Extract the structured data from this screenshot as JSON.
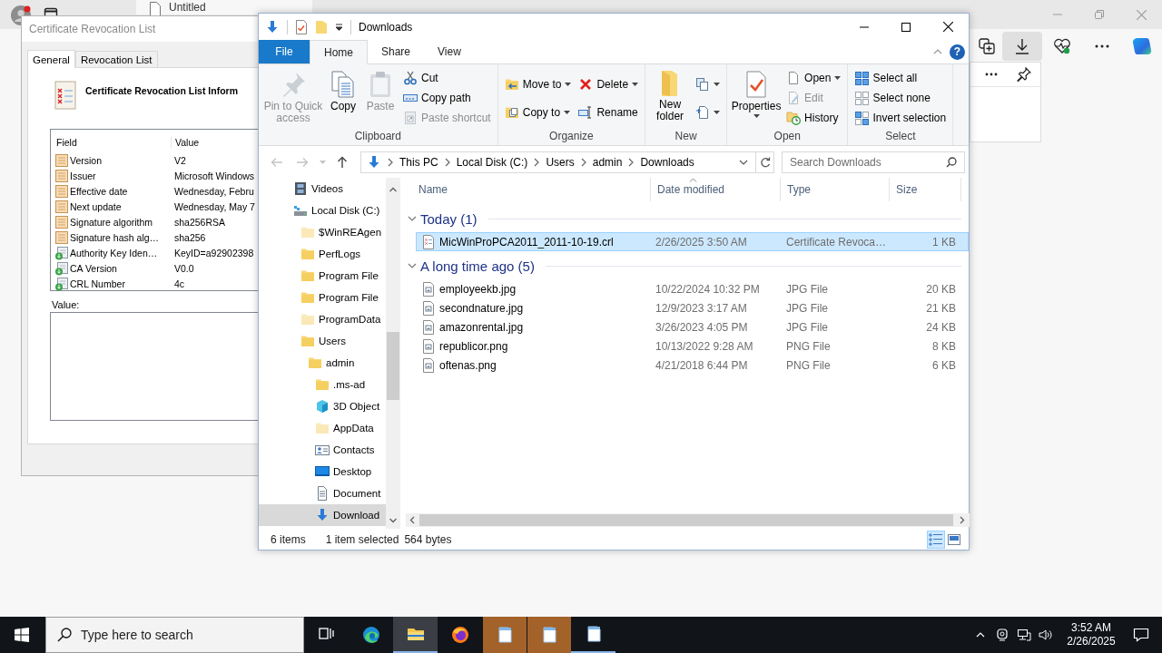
{
  "browser": {
    "tab_title": "Untitled"
  },
  "cert_dialog": {
    "title": "Certificate Revocation List",
    "tabs": [
      {
        "label": "General",
        "selected": true
      },
      {
        "label": "Revocation List",
        "selected": false
      }
    ],
    "heading": "Certificate Revocation List Inform",
    "columns": [
      "Field",
      "Value"
    ],
    "rows": [
      {
        "field": "Version",
        "value": "V2",
        "kind": "property"
      },
      {
        "field": "Issuer",
        "value": "Microsoft Windows",
        "kind": "property"
      },
      {
        "field": "Effective date",
        "value": "Wednesday, Febru",
        "kind": "property"
      },
      {
        "field": "Next update",
        "value": "Wednesday, May 7",
        "kind": "property"
      },
      {
        "field": "Signature algorithm",
        "value": "sha256RSA",
        "kind": "property"
      },
      {
        "field": "Signature hash alg…",
        "value": "sha256",
        "kind": "property"
      },
      {
        "field": "Authority Key Iden…",
        "value": "KeyID=a92902398",
        "kind": "extension"
      },
      {
        "field": "CA Version",
        "value": "V0.0",
        "kind": "extension"
      },
      {
        "field": "CRL Number",
        "value": "4c",
        "kind": "extension"
      }
    ],
    "value_label": "Value:"
  },
  "explorer": {
    "title": "Downloads",
    "ribbon": {
      "tabs": [
        {
          "label": "File",
          "kind": "backstage",
          "selected": false
        },
        {
          "label": "Home",
          "kind": "tab",
          "selected": true
        },
        {
          "label": "Share",
          "kind": "tab",
          "selected": false
        },
        {
          "label": "View",
          "kind": "tab",
          "selected": false
        }
      ],
      "groups": [
        {
          "label": "Clipboard",
          "columns": [
            [
              {
                "kind": "pin",
                "label": "Pin to Quick access",
                "large": true,
                "disabled": true,
                "dropdown": false
              }
            ],
            [
              {
                "kind": "copy",
                "label": "Copy",
                "large": true,
                "disabled": false,
                "dropdown": false
              }
            ],
            [
              {
                "kind": "paste",
                "label": "Paste",
                "large": true,
                "disabled": true,
                "dropdown": false
              }
            ],
            [
              {
                "kind": "cut",
                "label": "Cut",
                "large": false,
                "disabled": false,
                "dropdown": false
              },
              {
                "kind": "copypath",
                "label": "Copy path",
                "large": false,
                "disabled": false,
                "dropdown": false
              },
              {
                "kind": "shortcut",
                "label": "Paste shortcut",
                "large": false,
                "disabled": true,
                "dropdown": false
              }
            ]
          ]
        },
        {
          "label": "Organize",
          "columns": [
            [
              {
                "kind": "moveto",
                "label": "Move to",
                "large": false,
                "disabled": false,
                "dropdown": true
              },
              {
                "kind": "copyto",
                "label": "Copy to",
                "large": false,
                "disabled": false,
                "dropdown": true
              }
            ],
            [
              {
                "kind": "delete",
                "label": "Delete",
                "large": false,
                "disabled": false,
                "dropdown": true
              },
              {
                "kind": "rename",
                "label": "Rename",
                "large": false,
                "disabled": false,
                "dropdown": false
              }
            ]
          ]
        },
        {
          "label": "New",
          "columns": [
            [
              {
                "kind": "newfolder",
                "label": "New folder",
                "large": true,
                "disabled": false,
                "dropdown": false
              }
            ],
            [
              {
                "kind": "newitem",
                "large": false,
                "disabled": false,
                "dropdown": true
              },
              {
                "kind": "easyaccess",
                "large": false,
                "disabled": false,
                "dropdown": true
              }
            ]
          ]
        },
        {
          "label": "Open",
          "columns": [
            [
              {
                "kind": "properties",
                "label": "Properties",
                "large": true,
                "disabled": false,
                "dropdown": true
              }
            ],
            [
              {
                "kind": "open",
                "label": "Open",
                "large": false,
                "disabled": false,
                "dropdown": true
              },
              {
                "kind": "edit",
                "label": "Edit",
                "large": false,
                "disabled": true,
                "dropdown": false
              },
              {
                "kind": "history",
                "label": "History",
                "large": false,
                "disabled": false,
                "dropdown": false
              }
            ]
          ]
        },
        {
          "label": "Select",
          "columns": [
            [
              {
                "kind": "selectall",
                "label": "Select all",
                "large": false,
                "disabled": false,
                "dropdown": false
              },
              {
                "kind": "selectnone",
                "label": "Select none",
                "large": false,
                "disabled": false,
                "dropdown": false
              },
              {
                "kind": "invert",
                "label": "Invert selection",
                "large": false,
                "disabled": false,
                "dropdown": false
              }
            ]
          ]
        }
      ]
    },
    "help": "?",
    "breadcrumb": [
      "This PC",
      "Local Disk (C:)",
      "Users",
      "admin",
      "Downloads"
    ],
    "search": {
      "placeholder": "Search Downloads"
    },
    "nav": [
      {
        "label": "Videos",
        "kind": "videos",
        "hidden": false,
        "selected": false
      },
      {
        "label": "Local Disk (C:)",
        "kind": "drive",
        "hidden": false,
        "selected": false,
        "children": [
          {
            "label": "$WinREAgen",
            "kind": "folder",
            "hidden": true,
            "selected": false
          },
          {
            "label": "PerfLogs",
            "kind": "folder",
            "hidden": false,
            "selected": false
          },
          {
            "label": "Program File",
            "kind": "folder",
            "hidden": false,
            "selected": false
          },
          {
            "label": "Program File",
            "kind": "folder",
            "hidden": false,
            "selected": false
          },
          {
            "label": "ProgramData",
            "kind": "folder",
            "hidden": true,
            "selected": false
          },
          {
            "label": "Users",
            "kind": "folder",
            "hidden": false,
            "selected": false,
            "children": [
              {
                "label": "admin",
                "kind": "folder",
                "hidden": false,
                "selected": false,
                "children": [
                  {
                    "label": ".ms-ad",
                    "kind": "folder",
                    "hidden": false,
                    "selected": false
                  },
                  {
                    "label": "3D Object",
                    "kind": "objects",
                    "hidden": false,
                    "selected": false
                  },
                  {
                    "label": "AppData",
                    "kind": "folder",
                    "hidden": true,
                    "selected": false
                  },
                  {
                    "label": "Contacts",
                    "kind": "contacts",
                    "hidden": false,
                    "selected": false
                  },
                  {
                    "label": "Desktop",
                    "kind": "desktop",
                    "hidden": false,
                    "selected": false
                  },
                  {
                    "label": "Document",
                    "kind": "documents",
                    "hidden": false,
                    "selected": false
                  },
                  {
                    "label": "Download",
                    "kind": "downloads",
                    "hidden": false,
                    "selected": true
                  }
                ]
              }
            ]
          }
        ]
      }
    ],
    "columns": [
      {
        "label": "Name",
        "sorted": false
      },
      {
        "label": "Date modified",
        "sorted": true
      },
      {
        "label": "Type",
        "sorted": false
      },
      {
        "label": "Size",
        "sorted": false
      }
    ],
    "groups": [
      {
        "label": "Today (1)",
        "expanded": true,
        "files": [
          {
            "name": "MicWinProPCA2011_2011-10-19.crl",
            "kind": "certificate",
            "date": "2/26/2025 3:50 AM",
            "type": "Certificate Revoca…",
            "size": "1 KB",
            "selected": true
          }
        ]
      },
      {
        "label": "A long time ago (5)",
        "expanded": true,
        "files": [
          {
            "name": "employeekb.jpg",
            "kind": "image",
            "date": "10/22/2024 10:32 PM",
            "type": "JPG File",
            "size": "20 KB",
            "selected": false
          },
          {
            "name": "secondnature.jpg",
            "kind": "image",
            "date": "12/9/2023 3:17 AM",
            "type": "JPG File",
            "size": "21 KB",
            "selected": false
          },
          {
            "name": "amazonrental.jpg",
            "kind": "image",
            "date": "3/26/2023 4:05 PM",
            "type": "JPG File",
            "size": "24 KB",
            "selected": false
          },
          {
            "name": "republicor.png",
            "kind": "image",
            "date": "10/13/2022 9:28 AM",
            "type": "PNG File",
            "size": "8 KB",
            "selected": false
          },
          {
            "name": "oftenas.png",
            "kind": "image",
            "date": "4/21/2018 6:44 PM",
            "type": "PNG File",
            "size": "6 KB",
            "selected": false
          }
        ]
      }
    ],
    "status": {
      "count": "6 items",
      "selection": "1 item selected",
      "size": "564 bytes"
    },
    "view_modes": [
      {
        "kind": "details",
        "selected": true
      },
      {
        "kind": "tiles",
        "selected": false
      }
    ]
  },
  "taskbar": {
    "search_placeholder": "Type here to search",
    "apps": [
      {
        "kind": "taskview",
        "active": false,
        "flashing": false,
        "open": false
      },
      {
        "kind": "edge",
        "active": false,
        "flashing": false,
        "open": false
      },
      {
        "kind": "explorer",
        "active": true,
        "flashing": false,
        "open": true
      },
      {
        "kind": "firefox",
        "active": false,
        "flashing": false,
        "open": false
      },
      {
        "kind": "notepad",
        "active": false,
        "flashing": true,
        "open": false
      },
      {
        "kind": "notepad",
        "active": false,
        "flashing": true,
        "open": false
      },
      {
        "kind": "notepad",
        "active": false,
        "flashing": false,
        "open": true
      }
    ],
    "time": "3:52 AM",
    "date": "2/26/2025"
  }
}
